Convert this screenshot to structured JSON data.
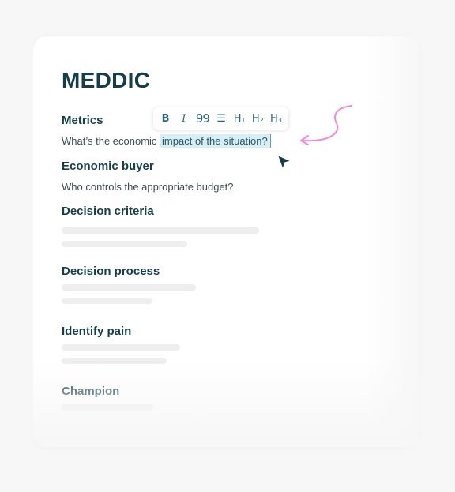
{
  "doc": {
    "title": "MEDDIC",
    "sections": [
      {
        "heading": "Metrics",
        "text_before": "What’s the economic ",
        "text_selected": "impact of the situation?"
      },
      {
        "heading": "Economic buyer",
        "text": "Who controls the appropriate budget?"
      },
      {
        "heading": "Decision criteria"
      },
      {
        "heading": "Decision process"
      },
      {
        "heading": "Identify pain"
      },
      {
        "heading": "Champion"
      }
    ]
  },
  "toolbar": {
    "buttons": [
      {
        "name": "bold",
        "label": "B"
      },
      {
        "name": "italic",
        "label": "I"
      },
      {
        "name": "quote",
        "label": "99"
      },
      {
        "name": "bullet-list",
        "label": "☰"
      },
      {
        "name": "heading-1",
        "label": "H",
        "sub": "1"
      },
      {
        "name": "heading-2",
        "label": "H",
        "sub": "2"
      },
      {
        "name": "heading-3",
        "label": "H",
        "sub": "3"
      }
    ]
  },
  "colors": {
    "heading": "#163d4a",
    "selection": "#d8eef5",
    "toolbar_icon": "#2f6377",
    "annotation_arrow": "#f28ad6",
    "cursor": "#163d4a"
  }
}
